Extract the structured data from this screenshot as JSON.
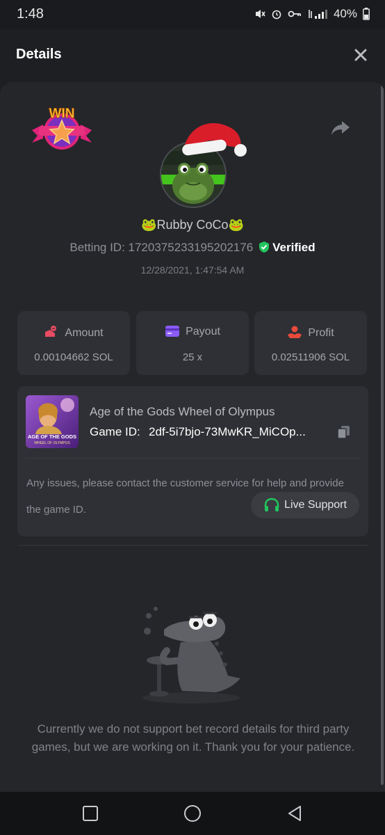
{
  "status_bar": {
    "time": "1:48",
    "battery": "40%",
    "icons": [
      "mute-icon",
      "alarm-icon",
      "key-icon",
      "signal-icon",
      "battery-icon"
    ]
  },
  "header": {
    "title": "Details",
    "close_icon": "close-icon"
  },
  "profile": {
    "badge_text": "WIN",
    "user_name": "🐸Rubby CoCo🐸",
    "betting_id": "Betting ID: 1720375233195202176",
    "verified_label": "Verified",
    "timestamp": "12/28/2021, 1:47:54 AM"
  },
  "stats": [
    {
      "label": "Amount",
      "value": "0.00104662 SOL",
      "icon": "amount-icon",
      "color": "#e84b62"
    },
    {
      "label": "Payout",
      "value": "25 x",
      "icon": "payout-icon",
      "color": "#8b5cf6"
    },
    {
      "label": "Profit",
      "value": "0.02511906 SOL",
      "icon": "profit-icon",
      "color": "#e84b3c"
    }
  ],
  "game": {
    "title": "Age of the Gods Wheel of Olympus",
    "id_label": "Game ID:",
    "id_value": "2df-5i7bjo-73MwKR_MiCOp...",
    "thumb_text": "AGE OF THE GODS",
    "thumb_subtext": "WHEEL OF OLYMPUS",
    "help_text": "Any issues, please contact the customer service for help and provide the game ID.",
    "support_label": "Live Support"
  },
  "notice": "Currently we do not support bet record details for third party games, but we are working on it. Thank you for your patience.",
  "colors": {
    "background": "#1e1f22",
    "card": "#2f3035",
    "verified_green": "#22c55e",
    "support_green": "#22c55e"
  }
}
